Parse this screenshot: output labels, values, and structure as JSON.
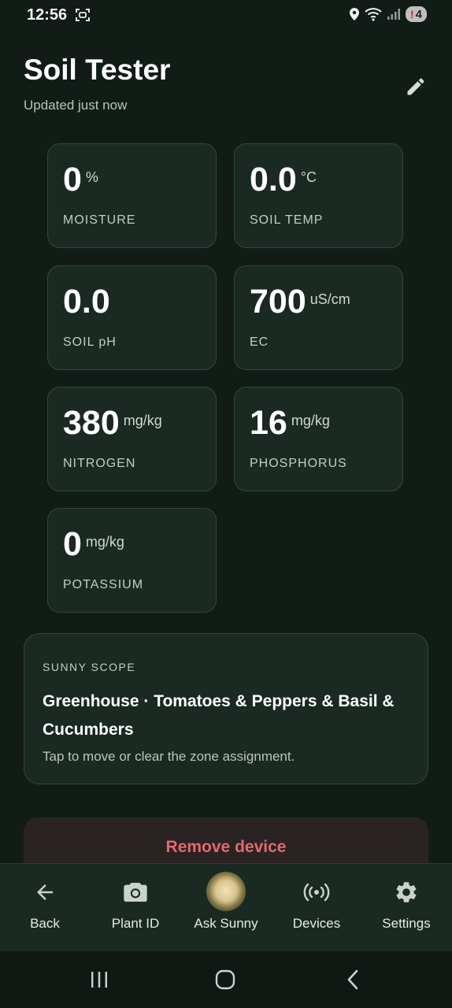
{
  "status_bar": {
    "time": "12:56",
    "notification_count": "4",
    "notification_alert": "!"
  },
  "header": {
    "title": "Soil Tester",
    "subtitle": "Updated just now"
  },
  "metrics": [
    {
      "value": "0",
      "unit": "%",
      "label": "MOISTURE"
    },
    {
      "value": "0.0",
      "unit": "°C",
      "label": "SOIL TEMP"
    },
    {
      "value": "0.0",
      "unit": "",
      "label": "SOIL pH"
    },
    {
      "value": "700",
      "unit": "uS/cm",
      "label": "EC"
    },
    {
      "value": "380",
      "unit": "mg/kg",
      "label": "NITROGEN"
    },
    {
      "value": "16",
      "unit": "mg/kg",
      "label": "PHOSPHORUS"
    },
    {
      "value": "0",
      "unit": "mg/kg",
      "label": "POTASSIUM"
    }
  ],
  "scope": {
    "kicker": "SUNNY SCOPE",
    "title": "Greenhouse · Tomatoes & Peppers & Basil & Cucumbers",
    "hint": "Tap to move or clear the zone assignment."
  },
  "remove_button": {
    "label": "Remove device"
  },
  "bottom_nav": [
    {
      "label": "Back",
      "icon": "arrow-left-icon"
    },
    {
      "label": "Plant ID",
      "icon": "camera-icon"
    },
    {
      "label": "Ask Sunny",
      "icon": "sunny-orb-icon"
    },
    {
      "label": "Devices",
      "icon": "broadcast-icon"
    },
    {
      "label": "Settings",
      "icon": "gear-icon"
    }
  ],
  "colors": {
    "background": "#111c17",
    "card": "#1a2a22",
    "danger": "#e06a6f",
    "orb": "#d7c28a"
  }
}
